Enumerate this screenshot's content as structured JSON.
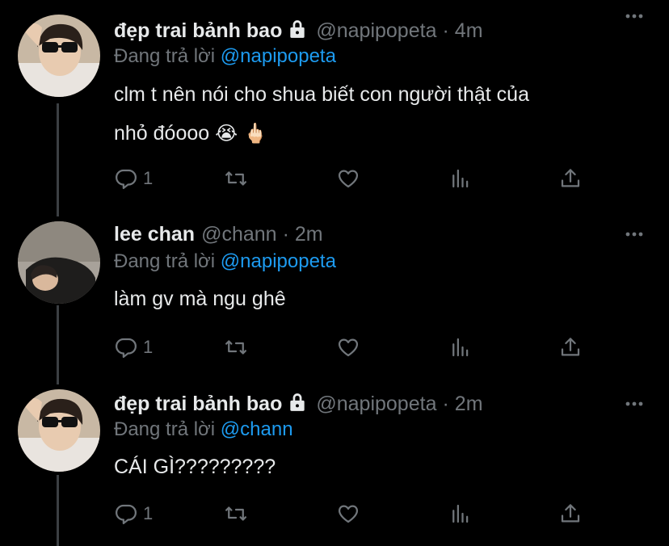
{
  "tweets": [
    {
      "name": "đẹp trai bảnh bao",
      "locked": true,
      "handle": "@napipopeta",
      "separator": "·",
      "time": "4m",
      "replying_prefix": "Đang trả lời ",
      "replying_to": "@napipopeta",
      "text_line1": "clm t nên nói cho shua biết con người thật của",
      "text_line2": "nhỏ đóooo",
      "emoji1": "😭",
      "emoji2": "🖕🏻",
      "reply_count": "1"
    },
    {
      "name": "lee chan",
      "locked": false,
      "handle": "@chann",
      "separator": "·",
      "time": "2m",
      "replying_prefix": "Đang trả lời ",
      "replying_to": "@napipopeta",
      "text_line1": "làm gv mà ngu ghê",
      "reply_count": "1"
    },
    {
      "name": "đẹp trai bảnh bao",
      "locked": true,
      "handle": "@napipopeta",
      "separator": "·",
      "time": "2m",
      "replying_prefix": "Đang trả lời ",
      "replying_to": "@chann",
      "text_line1": "CÁI GÌ?????????",
      "reply_count": "1"
    }
  ],
  "icons": [
    "reply-icon",
    "retweet-icon",
    "like-icon",
    "analytics-icon",
    "share-icon",
    "more-icon",
    "lock-icon"
  ],
  "colors": {
    "background": "#000000",
    "text": "#e7e9ea",
    "secondary": "#71767b",
    "accent": "#1d9bf0"
  }
}
